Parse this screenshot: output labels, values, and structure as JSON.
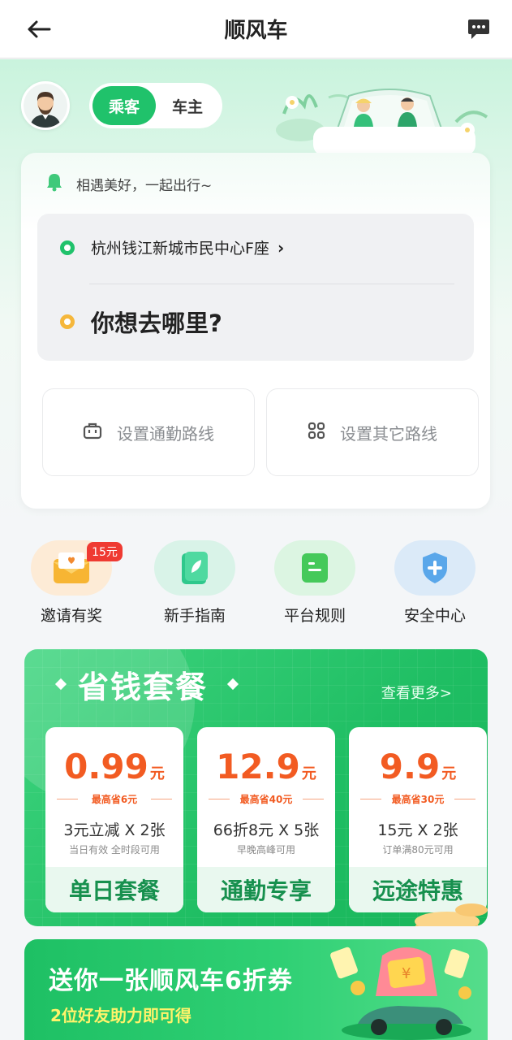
{
  "header": {
    "title": "顺风车"
  },
  "roles": {
    "passenger": "乘客",
    "driver": "车主",
    "active": "乘客"
  },
  "trip": {
    "slogan": "相遇美好，一起出行~",
    "from": "杭州钱江新城市民中心F座",
    "from_chevron": "›",
    "to_placeholder": "你想去哪里?",
    "commute_route": "设置通勤路线",
    "other_route": "设置其它路线"
  },
  "quick_entries": [
    {
      "label": "邀请有奖",
      "icon": "gift-envelope-icon"
    },
    {
      "label": "新手指南",
      "icon": "guide-book-icon"
    },
    {
      "label": "平台规则",
      "icon": "rules-doc-icon"
    },
    {
      "label": "安全中心",
      "icon": "shield-plus-icon"
    }
  ],
  "invite_badge": "15元",
  "packages": {
    "title": "省钱套餐",
    "more": "查看更多>",
    "items": [
      {
        "price": "0.99",
        "unit": "元",
        "save": "最高省6元",
        "desc": "3元立减 X 2张",
        "sub": "当日有效 全时段可用",
        "name": "单日套餐"
      },
      {
        "price": "12.9",
        "unit": "元",
        "save": "最高省40元",
        "desc": "66折8元 X 5张",
        "sub": "早晚高峰可用",
        "name": "通勤专享"
      },
      {
        "price": "9.9",
        "unit": "元",
        "save": "最高省30元",
        "desc": "15元 X 2张",
        "sub": "订单满80元可用",
        "name": "远途特惠"
      }
    ]
  },
  "banner": {
    "title": "送你一张顺风车6折券",
    "subtitle": "2位好友助力即可得"
  },
  "colors": {
    "brand_green": "#20c26b",
    "price_orange": "#f25b22",
    "badge_red": "#ef3a32"
  }
}
